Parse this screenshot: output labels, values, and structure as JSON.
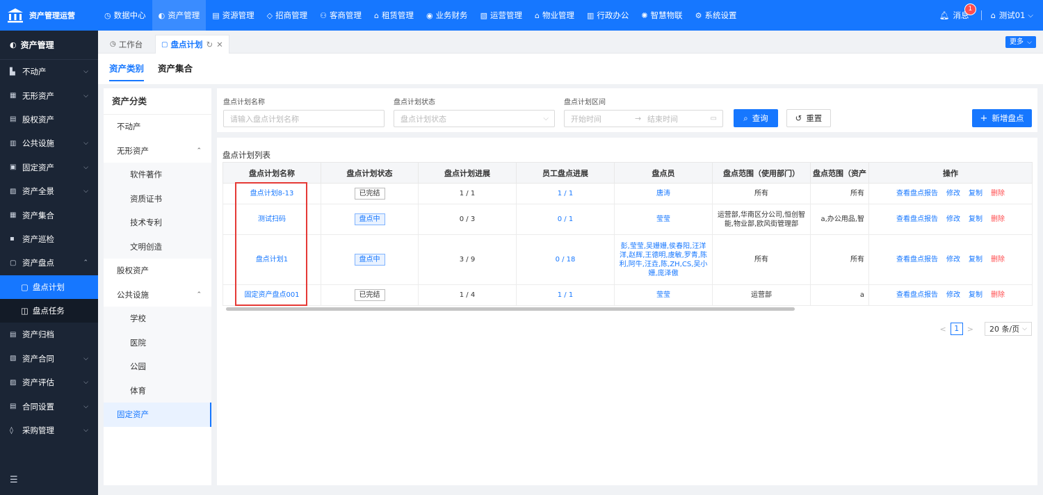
{
  "app": {
    "title": "资产管理运营"
  },
  "topnav": [
    {
      "icon": "◷",
      "label": "数据中心"
    },
    {
      "icon": "◐",
      "label": "资产管理"
    },
    {
      "icon": "▤",
      "label": "资源管理"
    },
    {
      "icon": "◇",
      "label": "招商管理"
    },
    {
      "icon": "⚇",
      "label": "客商管理"
    },
    {
      "icon": "⌂",
      "label": "租赁管理"
    },
    {
      "icon": "◉",
      "label": "业务财务"
    },
    {
      "icon": "▧",
      "label": "运营管理"
    },
    {
      "icon": "⌂",
      "label": "物业管理"
    },
    {
      "icon": "▥",
      "label": "行政办公"
    },
    {
      "icon": "✺",
      "label": "智慧物联"
    },
    {
      "icon": "⚙",
      "label": "系统设置"
    }
  ],
  "topright": {
    "messages": "消息",
    "badge": "1",
    "user": "测试01"
  },
  "sidebar": {
    "header": "资产管理",
    "items": [
      {
        "icon": "▙",
        "label": "不动产",
        "chev": "⌵"
      },
      {
        "icon": "▦",
        "label": "无形资产",
        "chev": "⌵"
      },
      {
        "icon": "▤",
        "label": "股权资产",
        "chev": ""
      },
      {
        "icon": "▥",
        "label": "公共设施",
        "chev": "⌵"
      },
      {
        "icon": "▣",
        "label": "固定资产",
        "chev": "⌵"
      },
      {
        "icon": "▨",
        "label": "资产全景",
        "chev": "⌵"
      },
      {
        "icon": "▦",
        "label": "资产集合",
        "chev": ""
      },
      {
        "icon": "▪",
        "label": "资产巡检",
        "chev": ""
      },
      {
        "icon": "▢",
        "label": "资产盘点",
        "chev": "⌃"
      }
    ],
    "sub": [
      {
        "icon": "▢",
        "label": "盘点计划"
      },
      {
        "icon": "◫",
        "label": "盘点任务"
      }
    ],
    "items2": [
      {
        "icon": "▤",
        "label": "资产归档",
        "chev": ""
      },
      {
        "icon": "▧",
        "label": "资产合同",
        "chev": "⌵"
      },
      {
        "icon": "▨",
        "label": "资产评估",
        "chev": "⌵"
      },
      {
        "icon": "▤",
        "label": "合同设置",
        "chev": "⌵"
      },
      {
        "icon": "◊",
        "label": "采购管理",
        "chev": "⌵"
      }
    ],
    "footer_icon": "☰"
  },
  "tabs": {
    "home": "工作台",
    "current": "盘点计划",
    "more": "更多"
  },
  "subtabs": [
    "资产类别",
    "资产集合"
  ],
  "category": {
    "title": "资产分类",
    "items": [
      {
        "label": "不动产",
        "level": 0,
        "expand": ""
      },
      {
        "label": "无形资产",
        "level": 0,
        "expand": "⌃"
      },
      {
        "label": "软件著作",
        "level": 1
      },
      {
        "label": "资质证书",
        "level": 1
      },
      {
        "label": "技术专利",
        "level": 1
      },
      {
        "label": "文明创造",
        "level": 1
      },
      {
        "label": "股权资产",
        "level": 0,
        "expand": ""
      },
      {
        "label": "公共设施",
        "level": 0,
        "expand": "⌃"
      },
      {
        "label": "学校",
        "level": 1
      },
      {
        "label": "医院",
        "level": 1
      },
      {
        "label": "公园",
        "level": 1
      },
      {
        "label": "体育",
        "level": 1
      },
      {
        "label": "固定资产",
        "level": 0,
        "expand": "",
        "selected": true
      }
    ]
  },
  "filter": {
    "name_label": "盘点计划名称",
    "name_placeholder": "请输入盘点计划名称",
    "status_label": "盘点计划状态",
    "status_placeholder": "盘点计划状态",
    "range_label": "盘点计划区间",
    "start_placeholder": "开始时间",
    "range_arrow": "→",
    "end_placeholder": "结束时间",
    "query": "查询",
    "reset": "重置",
    "add": "新增盘点"
  },
  "table": {
    "title": "盘点计划列表",
    "columns": [
      "盘点计划名称",
      "盘点计划状态",
      "盘点计划进展",
      "员工盘点进展",
      "盘点员",
      "盘点范围（使用部门）",
      "盘点范围（资产",
      "操作"
    ],
    "rows": [
      {
        "name": "盘点计划8-13",
        "status": "已完结",
        "status_type": "done",
        "progress": "1 / 1",
        "emp": "1 / 1",
        "staff": "唐涛",
        "dept": "所有",
        "scope": "所有"
      },
      {
        "name": "测试扫码",
        "status": "盘点中",
        "status_type": "ing",
        "progress": "0 / 3",
        "emp": "0 / 1",
        "staff": "莹莹",
        "dept": "运营部,华南区分公司,恒创智能,物业部,欧风街管理部",
        "scope": "a,办公用品,智"
      },
      {
        "name": "盘点计划1",
        "status": "盘点中",
        "status_type": "ing",
        "progress": "3 / 9",
        "emp": "0 / 18",
        "staff": "彭,莹莹,吴姗姗,侯春阳,汪洋洋,赵辉,王德明,虞敏,罗青,陈利,阿牛,汪垚,陈,ZH,CS,吴小姗,庞泽傲",
        "dept": "所有",
        "scope": "所有"
      },
      {
        "name": "固定资产盘点001",
        "status": "已完结",
        "status_type": "done",
        "progress": "1 / 4",
        "emp": "1 / 1",
        "staff": "莹莹",
        "dept": "运营部",
        "scope": "a"
      }
    ],
    "ops": [
      "查看盘点报告",
      "修改",
      "复制",
      "删除"
    ]
  },
  "pager": {
    "prev": "<",
    "page": "1",
    "next": ">",
    "size": "20 条/页"
  }
}
